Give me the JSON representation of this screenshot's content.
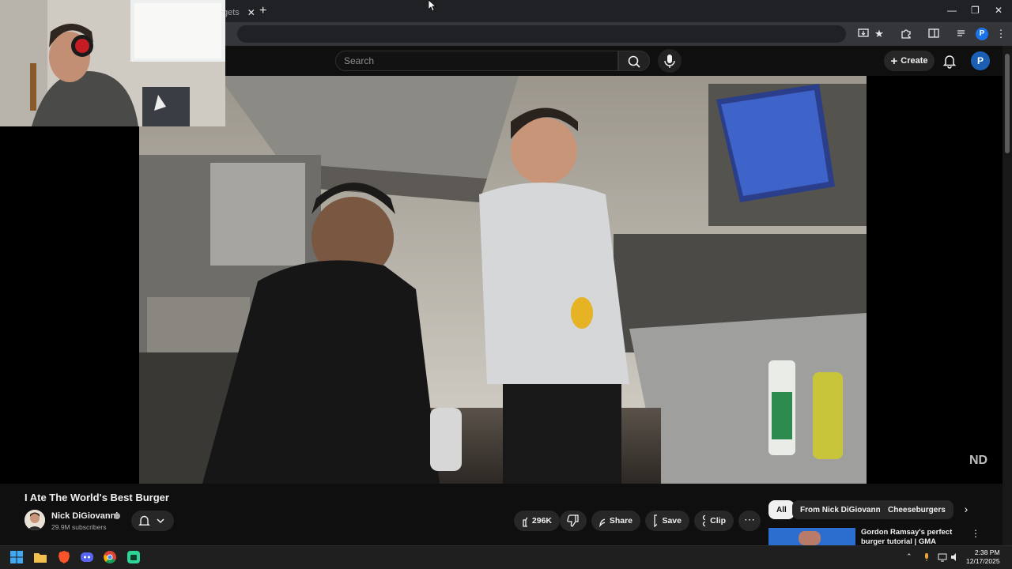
{
  "browser": {
    "tab_title": "gets",
    "tab_close": "✕",
    "new_tab": "+",
    "window_controls": [
      "—",
      "❐",
      "✕"
    ]
  },
  "header": {
    "search_placeholder": "Search",
    "create_label": "Create",
    "avatar_letter": "P"
  },
  "video": {
    "watermark": "ND",
    "title": "I Ate The World's Best Burger"
  },
  "channel": {
    "name": "Nick DiGiovanni",
    "subscribers": "29.9M subscribers"
  },
  "actions": {
    "likes": "296K",
    "share": "Share",
    "save": "Save",
    "clip": "Clip",
    "more": "⋯"
  },
  "chips": {
    "items": [
      "All",
      "From Nick DiGiovanni",
      "Cheeseburgers"
    ],
    "next": "›"
  },
  "recommendation": {
    "title": "Gordon Ramsay's perfect burger tutorial | GMA",
    "menu": "⋮"
  },
  "taskbar": {
    "time": "2:38 PM",
    "date": "12/17/2025",
    "tray_chevron": "⌃"
  },
  "colors": {
    "background": "#0f0f0f",
    "pill": "#272727",
    "avatar": "#1a5fb4",
    "text": "#f1f1f1"
  }
}
